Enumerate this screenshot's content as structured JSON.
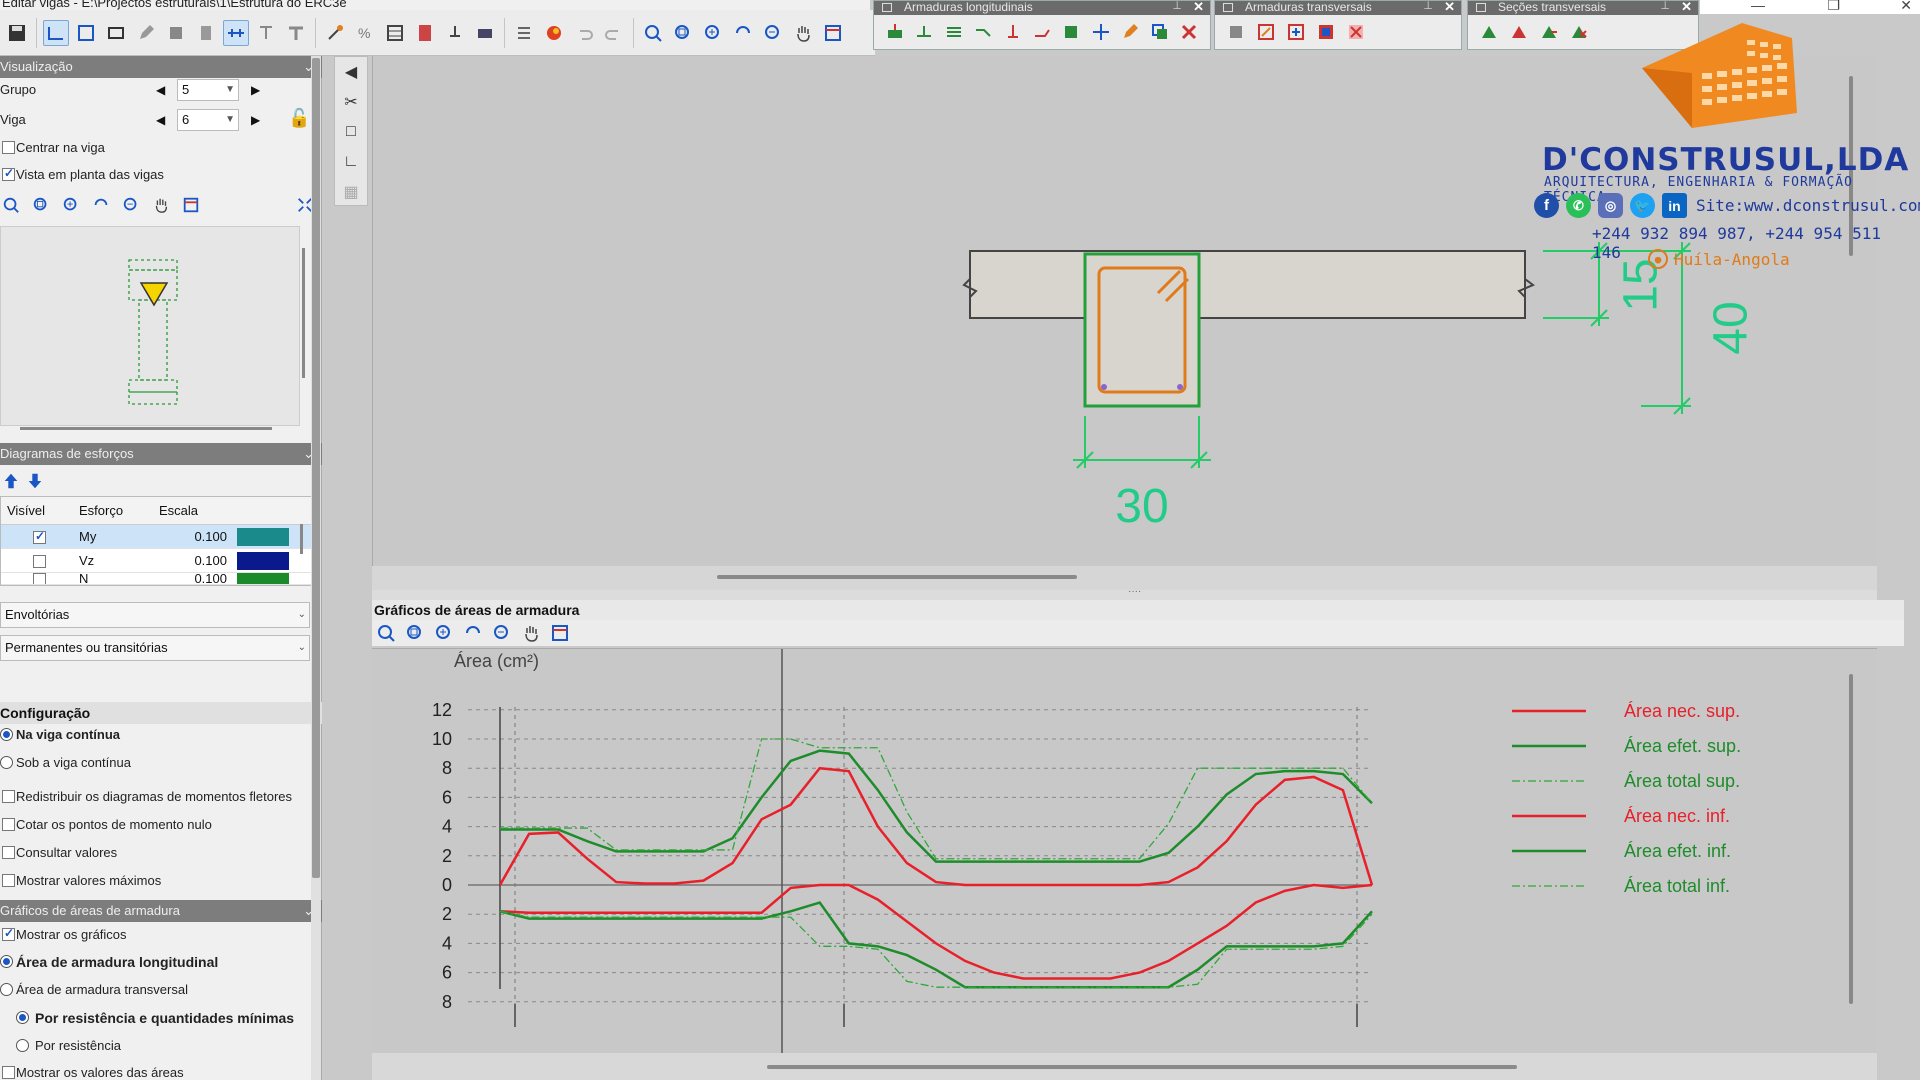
{
  "window": {
    "title": "Editar vigas - E:\\Projectos estruturais\\1\\Estrutura do ERC3e"
  },
  "floatbars": [
    {
      "title": "Armaduras longitudinais"
    },
    {
      "title": "Armaduras transversais"
    },
    {
      "title": "Seções transversais"
    }
  ],
  "left": {
    "visual_header": "Visualização",
    "grupo_label": "Grupo",
    "grupo_value": "5",
    "viga_label": "Viga",
    "viga_value": "6",
    "centrar_label": "Centrar na viga",
    "centrar_checked": false,
    "vista_label": "Vista em planta das vigas",
    "vista_checked": true,
    "diag_header": "Diagramas de esforços",
    "table_headers": [
      "Visível",
      "Esforço",
      "Escala"
    ],
    "table_rows": [
      {
        "visible": true,
        "esforco": "My",
        "escala": "0.100",
        "color": "#1a8a8a"
      },
      {
        "visible": false,
        "esforco": "Vz",
        "escala": "0.100",
        "color": "#0a1a8c"
      },
      {
        "visible": false,
        "esforco": "N",
        "escala": "0.100",
        "color": "#1a8a2a"
      }
    ],
    "combo1": "Envoltórias",
    "combo2": "Permanentes ou transitórias",
    "config_header": "Configuração",
    "config_options": [
      {
        "label": "Na viga contínua",
        "selected": true,
        "bold": true
      },
      {
        "label": "Sob a viga contínua",
        "selected": false,
        "bold": false
      }
    ],
    "config_checks": [
      {
        "label": "Redistribuir os diagramas de momentos fletores",
        "checked": false
      },
      {
        "label": "Cotar os pontos de momento nulo",
        "checked": false
      },
      {
        "label": "Consultar valores",
        "checked": false
      },
      {
        "label": "Mostrar valores máximos",
        "checked": false
      }
    ],
    "graf_header": "Gráficos de áreas de armadura",
    "mostrar_graficos": "Mostrar os gráficos",
    "mostrar_graficos_checked": true,
    "area_long": "Área de armadura longitudinal",
    "area_trans": "Área de armadura transversal",
    "por_res_min": "Por resistência e quantidades mínimas",
    "por_res": "Por resistência",
    "mostrar_valores": "Mostrar os valores das áreas"
  },
  "section": {
    "width_label": "30",
    "slab_label": "15",
    "height_label": "40"
  },
  "chart": {
    "panel_title": "Gráficos de áreas de armadura"
  },
  "chart_data": {
    "type": "line",
    "title": "",
    "ylabel": "Área (cm²)",
    "xlabel": "",
    "ytick_labels_top": [
      "12",
      "10",
      "8",
      "6",
      "4",
      "2",
      "0"
    ],
    "ytick_labels_bottom": [
      "2",
      "4",
      "6",
      "8"
    ],
    "ylim": [
      -8,
      12
    ],
    "grid": true,
    "legend_position": "right",
    "x": [
      0,
      1,
      2,
      3,
      4,
      5,
      6,
      7,
      8,
      9,
      10,
      11,
      12,
      13,
      14,
      15,
      16,
      17,
      18,
      19,
      20,
      21,
      22,
      23,
      24,
      25,
      26,
      27,
      28,
      29,
      30
    ],
    "series": [
      {
        "name": "Área nec. sup.",
        "color": "#e8202a",
        "style": "solid",
        "values": [
          0,
          3.5,
          3.6,
          1.8,
          0.2,
          0.1,
          0.1,
          0.3,
          1.5,
          4.5,
          5.5,
          8,
          7.8,
          4,
          1.5,
          0.2,
          0,
          0,
          0,
          0,
          0,
          0,
          0,
          0.2,
          1.2,
          3,
          5.5,
          7.2,
          7.4,
          6.5,
          0
        ]
      },
      {
        "name": "Área efet. sup.",
        "color": "#1e8c2a",
        "style": "solid",
        "values": [
          3.8,
          3.8,
          3.8,
          3,
          2.3,
          2.3,
          2.3,
          2.3,
          3.2,
          6,
          8.5,
          9.2,
          9,
          6.5,
          3.6,
          1.6,
          1.6,
          1.6,
          1.6,
          1.6,
          1.6,
          1.6,
          1.6,
          2.2,
          4,
          6.2,
          7.6,
          7.8,
          7.8,
          7.6,
          5.6
        ]
      },
      {
        "name": "Área total sup.",
        "color": "#2fa83a",
        "style": "dashdot",
        "values": [
          3.9,
          3.9,
          3.9,
          3.9,
          2.4,
          2.4,
          2.4,
          2.4,
          2.4,
          10,
          10,
          9.4,
          9.4,
          9.4,
          5,
          1.8,
          1.8,
          1.8,
          1.8,
          1.8,
          1.8,
          1.8,
          1.8,
          4.2,
          8,
          8,
          8,
          8,
          8,
          8,
          5.6
        ]
      },
      {
        "name": "Área nec. inf.",
        "color": "#e8202a",
        "style": "solid",
        "values": [
          -1.8,
          -1.9,
          -1.9,
          -1.9,
          -1.9,
          -1.9,
          -1.9,
          -1.9,
          -1.9,
          -1.9,
          -0.2,
          0,
          0,
          -1,
          -2.5,
          -4,
          -5.2,
          -6,
          -6.4,
          -6.4,
          -6.4,
          -6.4,
          -6,
          -5.2,
          -4,
          -2.8,
          -1.2,
          -0.4,
          0,
          -0.2,
          0
        ]
      },
      {
        "name": "Área efet. inf.",
        "color": "#1e8c2a",
        "style": "solid",
        "values": [
          -1.8,
          -2.3,
          -2.3,
          -2.3,
          -2.3,
          -2.3,
          -2.3,
          -2.3,
          -2.3,
          -2.3,
          -1.8,
          -1.2,
          -4,
          -4.2,
          -4.8,
          -5.8,
          -7,
          -7,
          -7,
          -7,
          -7,
          -7,
          -7,
          -7,
          -5.8,
          -4.2,
          -4.2,
          -4.2,
          -4.2,
          -4,
          -1.8
        ]
      },
      {
        "name": "Área total inf.",
        "color": "#2fa83a",
        "style": "dashdot",
        "values": [
          -1.8,
          -2.2,
          -2.2,
          -2.2,
          -2.2,
          -2.2,
          -2.2,
          -2.2,
          -2.2,
          -2.2,
          -2.2,
          -4.2,
          -4.2,
          -4.4,
          -6.6,
          -7,
          -7,
          -7,
          -7,
          -7,
          -7,
          -7,
          -7,
          -7,
          -6.8,
          -4.4,
          -4.4,
          -4.4,
          -4.4,
          -4.2,
          -2
        ]
      }
    ]
  },
  "logo": {
    "brand": "D'CONSTRUSUL,LDA",
    "tagline": "ARQUITECTURA, ENGENHARIA & FORMAÇÃO TÉCNICA",
    "site": "Site:www.dconstrusul.com",
    "phones": "+244 932 894 987, +244 954 511 146",
    "place": "Huíla-Angola"
  }
}
